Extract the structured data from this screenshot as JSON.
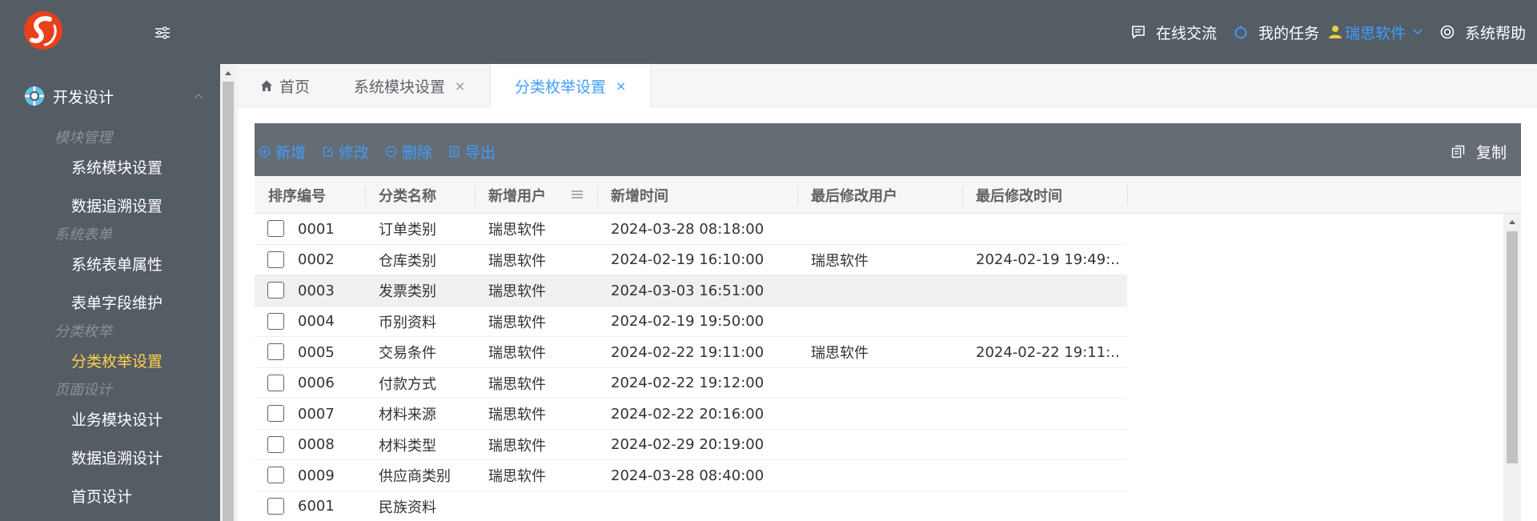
{
  "header": {
    "online_chat": "在线交流",
    "my_tasks": "我的任务",
    "user": "瑞思软件",
    "help": "系统帮助"
  },
  "sidebar": {
    "section": "开发设计",
    "groups": [
      "模块管理",
      "系统表单",
      "分类枚举",
      "页面设计"
    ],
    "items": [
      "系统模块设置",
      "数据追溯设置",
      "系统表单属性",
      "表单字段维护",
      "分类枚举设置",
      "业务模块设计",
      "数据追溯设计",
      "首页设计"
    ]
  },
  "tabs": [
    {
      "label": "首页"
    },
    {
      "label": "系统模块设置",
      "close": "×"
    },
    {
      "label": "分类枚举设置",
      "close": "×"
    }
  ],
  "toolbar": {
    "add": "新增",
    "edit": "修改",
    "delete": "删除",
    "export": "导出",
    "copy": "复制"
  },
  "table": {
    "columns": [
      "排序编号",
      "分类名称",
      "新增用户",
      "新增时间",
      "最后修改用户",
      "最后修改时间"
    ],
    "rows": [
      [
        "0001",
        "订单类别",
        "瑞思软件",
        "2024-03-28 08:18:00",
        "",
        ""
      ],
      [
        "0002",
        "仓库类别",
        "瑞思软件",
        "2024-02-19 16:10:00",
        "瑞思软件",
        "2024-02-19 19:49:..."
      ],
      [
        "0003",
        "发票类别",
        "瑞思软件",
        "2024-03-03 16:51:00",
        "",
        ""
      ],
      [
        "0004",
        "币别资料",
        "瑞思软件",
        "2024-02-19 19:50:00",
        "",
        ""
      ],
      [
        "0005",
        "交易条件",
        "瑞思软件",
        "2024-02-22 19:11:00",
        "瑞思软件",
        "2024-02-22 19:11:..."
      ],
      [
        "0006",
        "付款方式",
        "瑞思软件",
        "2024-02-22 19:12:00",
        "",
        ""
      ],
      [
        "0007",
        "材料来源",
        "瑞思软件",
        "2024-02-22 20:16:00",
        "",
        ""
      ],
      [
        "0008",
        "材料类型",
        "瑞思软件",
        "2024-02-29 20:19:00",
        "",
        ""
      ],
      [
        "0009",
        "供应商类别",
        "瑞思软件",
        "2024-03-28 08:40:00",
        "",
        ""
      ],
      [
        "6001",
        "民族资料",
        "",
        "",
        "",
        ""
      ]
    ]
  },
  "colors": {
    "header_bg": "#545c64",
    "accent": "#409eff",
    "active_menu": "#ffd04b"
  }
}
